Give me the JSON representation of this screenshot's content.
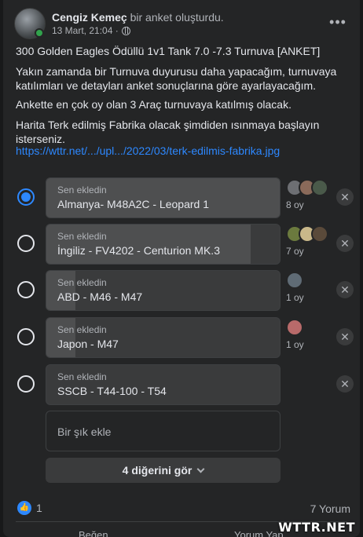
{
  "header": {
    "author": "Cengiz Kemeç",
    "action": "bir anket oluşturdu.",
    "timestamp": "13 Mart, 21:04 ·",
    "privacy_icon": "globe-icon",
    "more_icon": "more-icon"
  },
  "post": {
    "title": "300 Golden Eagles Ödüllü 1v1 Tank 7.0 -7.3 Turnuva [ANKET]",
    "para1": "Yakın zamanda bir Turnuva duyurusu daha yapacağım, turnuvaya katılımları ve detayları anket sonuçlarına göre ayarlayacağım.",
    "para2": "Ankette en çok oy olan 3 Araç turnuvaya katılmış olacak.",
    "para3": "Harita Terk edilmiş Fabrika olacak şimdiden ısınmaya başlayın isterseniz.",
    "link": "https://wttr.net/.../upl.../2022/03/terk-edilmis-fabrika.jpg"
  },
  "poll": {
    "options": [
      {
        "added_by": "Sen ekledin",
        "label": "Almanya- M48A2C - Leopard 1",
        "votes": "8 oy",
        "share": 1.0,
        "selected": true
      },
      {
        "added_by": "Sen ekledin",
        "label": "İngiliz - FV4202 - Centurion MK.3",
        "votes": "7 oy",
        "share": 0.875,
        "selected": false
      },
      {
        "added_by": "Sen ekledin",
        "label": "ABD - M46 - M47",
        "votes": "1 oy",
        "share": 0.125,
        "selected": false
      },
      {
        "added_by": "Sen ekledin",
        "label": "Japon - M47",
        "votes": "1 oy",
        "share": 0.125,
        "selected": false
      },
      {
        "added_by": "Sen ekledin",
        "label": "SSCB - T44-100 - T54",
        "votes": "",
        "share": 0.0,
        "selected": false
      }
    ],
    "add_option_placeholder": "Bir şık ekle",
    "see_more": "4 diğerini gör"
  },
  "footer": {
    "like_count": "1",
    "comments": "7 Yorum",
    "like_button": "Beğen",
    "comment_button": "Yorum Yap"
  },
  "watermark": "WTTR.NET",
  "colors": {
    "accent": "#2d88ff",
    "card": "#242526",
    "option": "#3a3b3c"
  }
}
